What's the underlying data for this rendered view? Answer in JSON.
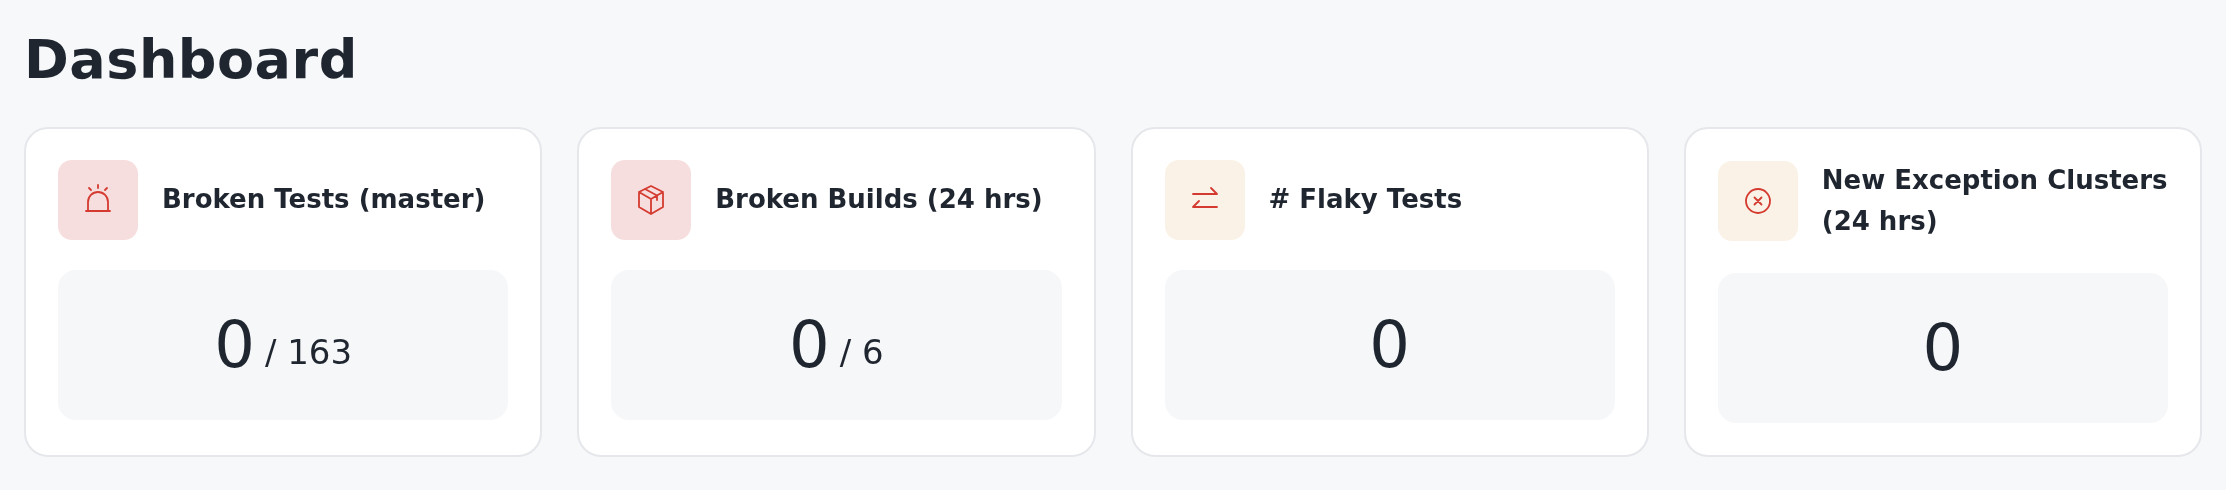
{
  "page": {
    "title": "Dashboard"
  },
  "cards": [
    {
      "kind": "alarm",
      "color": "#f7dede",
      "title": "Broken Tests (master)",
      "value": "0",
      "total": "/ 163"
    },
    {
      "kind": "package",
      "color": "#f7dede",
      "title": "Broken Builds (24 hrs)",
      "value": "0",
      "total": "/ 6"
    },
    {
      "kind": "arrows",
      "color": "#faf2e6",
      "title": "# Flaky Tests",
      "value": "0"
    },
    {
      "kind": "x-circle",
      "color": "#faf2e6",
      "title": "New Exception Clusters (24 hrs)",
      "value": "0"
    }
  ]
}
